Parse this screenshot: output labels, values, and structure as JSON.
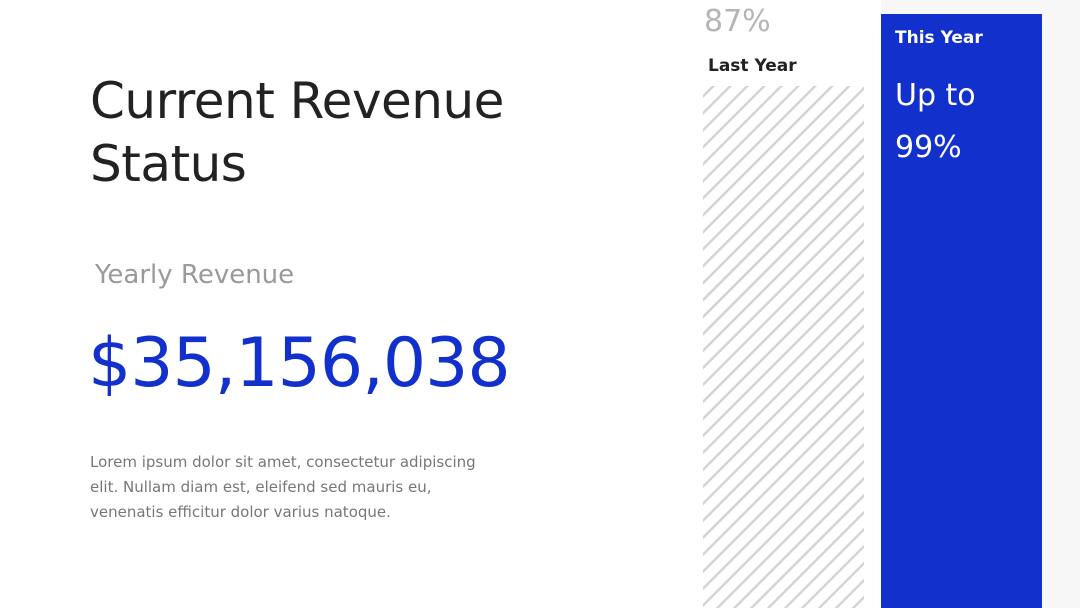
{
  "slide": {
    "title": "Current Revenue Status",
    "subtitle": "Yearly Revenue",
    "value": "$35,156,038",
    "body": "Lorem ipsum dolor sit amet, consectetur adipiscing elit. Nullam diam est, eleifend sed mauris eu, venenatis efficitur dolor varius natoque."
  },
  "colors": {
    "accent": "#1230cc",
    "stripe": "#d4d4d4",
    "muted": "#b5b5b5",
    "dark": "#222222"
  },
  "chart_data": {
    "type": "bar",
    "categories": [
      "Last Year",
      "This Year"
    ],
    "values": [
      87,
      99
    ],
    "value_labels": [
      "87%",
      "Up to 99%"
    ],
    "unit": "%",
    "ylim": [
      0,
      100
    ],
    "grid": false,
    "styles": [
      "hatched-gray",
      "solid-blue"
    ]
  }
}
